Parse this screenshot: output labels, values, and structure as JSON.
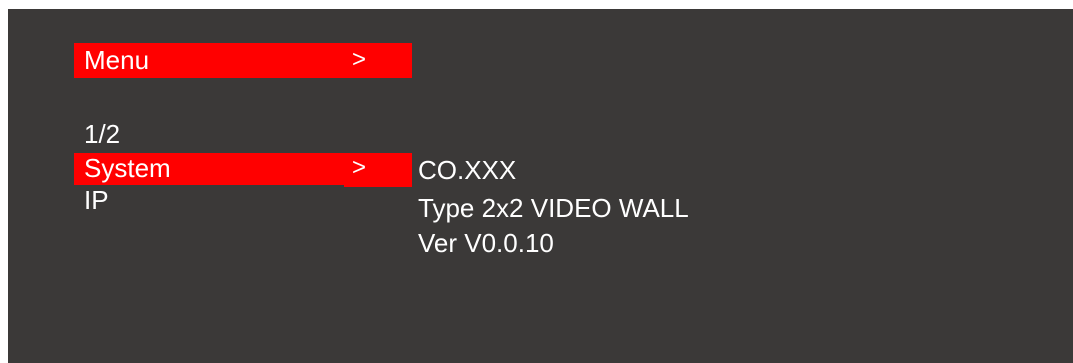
{
  "menu": {
    "title": "Menu",
    "arrow": ">"
  },
  "page_indicator": "1/2",
  "items": [
    {
      "label": "System",
      "arrow": ">",
      "selected": true
    },
    {
      "label": "IP",
      "selected": false
    }
  ],
  "info": {
    "company": "CO.XXX",
    "type": "Type 2x2 VIDEO WALL",
    "version": "Ver V0.0.10"
  },
  "colors": {
    "background": "#3b3938",
    "highlight": "#ff0000",
    "text": "#ffffff"
  }
}
